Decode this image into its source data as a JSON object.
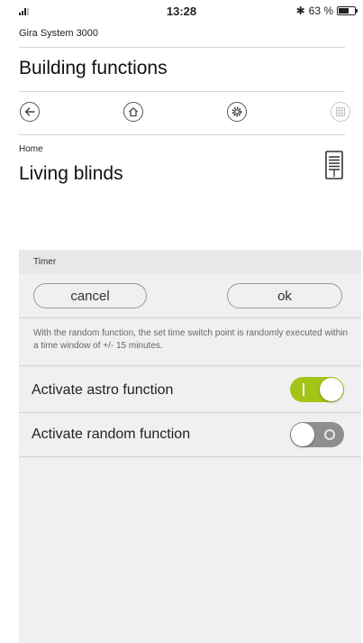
{
  "status_bar": {
    "time": "13:28",
    "bluetooth_icon": "bluetooth-icon",
    "battery_text": "63 %",
    "battery_level": 0.63
  },
  "header": {
    "system_name": "Gira System 3000",
    "title": "Building functions"
  },
  "nav": {
    "back_icon": "arrow-left-icon",
    "home_icon": "home-icon",
    "settings_icon": "gear-icon",
    "grid_icon": "grid-icon"
  },
  "location": {
    "breadcrumb": "Home",
    "title": "Living blinds",
    "device_icon": "blind-icon"
  },
  "timer": {
    "header": "Timer",
    "cancel_label": "cancel",
    "ok_label": "ok",
    "info": "With the random function, the set time switch point is randomly executed within a time window of +/- 15 minutes.",
    "astro_label": "Activate astro function",
    "astro_enabled": true,
    "random_label": "Activate random function",
    "random_enabled": false
  },
  "colors": {
    "toggle_on": "#a5c418",
    "toggle_off": "#8e8e8e",
    "panel_bg": "#f0f0f0"
  }
}
